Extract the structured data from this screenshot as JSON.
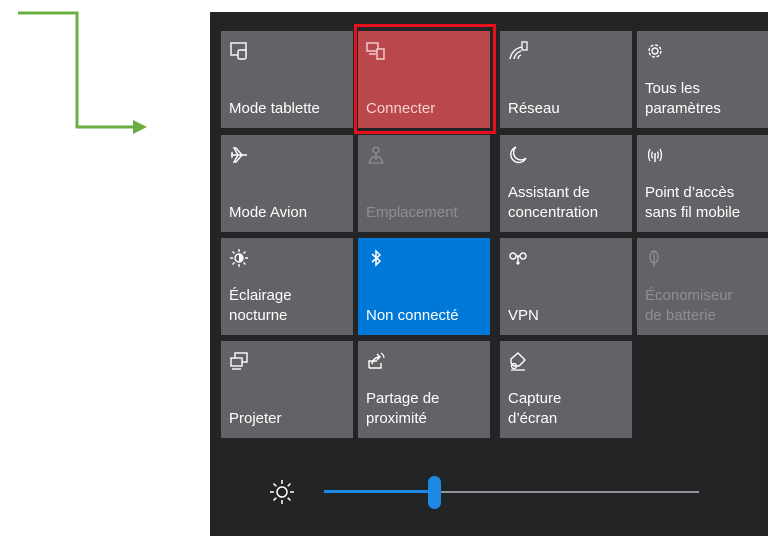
{
  "arrow_color": "#6aad41",
  "tiles": [
    {
      "label": "Mode tablette",
      "icon": "tablet-mode-icon",
      "state": "normal"
    },
    {
      "label": "Connecter",
      "icon": "connect-icon",
      "state": "highlighted"
    },
    {
      "label": "Réseau",
      "icon": "network-icon",
      "state": "normal"
    },
    {
      "label": "Tous les\nparamètres",
      "icon": "settings-gear-icon",
      "state": "normal"
    },
    {
      "label": "Mode Avion",
      "icon": "airplane-icon",
      "state": "normal"
    },
    {
      "label": "Emplacement",
      "icon": "location-icon",
      "state": "disabled"
    },
    {
      "label": "Assistant de\nconcentration",
      "icon": "moon-icon",
      "state": "normal"
    },
    {
      "label": "Point d’accès\nsans fil mobile",
      "icon": "hotspot-icon",
      "state": "normal"
    },
    {
      "label": "Éclairage\nnocturne",
      "icon": "night-light-icon",
      "state": "normal"
    },
    {
      "label": "Non connecté",
      "icon": "bluetooth-icon",
      "state": "active"
    },
    {
      "label": "VPN",
      "icon": "vpn-icon",
      "state": "normal"
    },
    {
      "label": "Économiseur\nde batterie",
      "icon": "battery-saver-icon",
      "state": "disabled"
    },
    {
      "label": "Projeter",
      "icon": "project-icon",
      "state": "normal"
    },
    {
      "label": "Partage de\nproximité",
      "icon": "nearby-sharing-icon",
      "state": "normal"
    },
    {
      "label": "Capture\nd’écran",
      "icon": "screen-snip-icon",
      "state": "normal"
    }
  ],
  "brightness": {
    "icon": "brightness-icon",
    "level": 0.3
  }
}
